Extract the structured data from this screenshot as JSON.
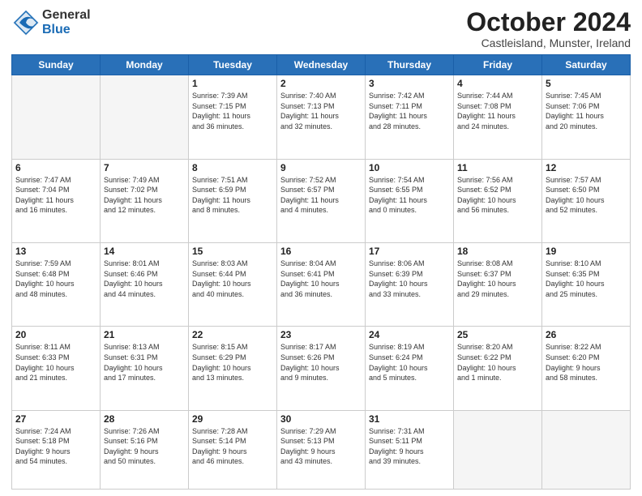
{
  "logo": {
    "general": "General",
    "blue": "Blue"
  },
  "title": "October 2024",
  "location": "Castleisland, Munster, Ireland",
  "days_of_week": [
    "Sunday",
    "Monday",
    "Tuesday",
    "Wednesday",
    "Thursday",
    "Friday",
    "Saturday"
  ],
  "weeks": [
    [
      {
        "day": "",
        "info": ""
      },
      {
        "day": "",
        "info": ""
      },
      {
        "day": "1",
        "info": "Sunrise: 7:39 AM\nSunset: 7:15 PM\nDaylight: 11 hours\nand 36 minutes."
      },
      {
        "day": "2",
        "info": "Sunrise: 7:40 AM\nSunset: 7:13 PM\nDaylight: 11 hours\nand 32 minutes."
      },
      {
        "day": "3",
        "info": "Sunrise: 7:42 AM\nSunset: 7:11 PM\nDaylight: 11 hours\nand 28 minutes."
      },
      {
        "day": "4",
        "info": "Sunrise: 7:44 AM\nSunset: 7:08 PM\nDaylight: 11 hours\nand 24 minutes."
      },
      {
        "day": "5",
        "info": "Sunrise: 7:45 AM\nSunset: 7:06 PM\nDaylight: 11 hours\nand 20 minutes."
      }
    ],
    [
      {
        "day": "6",
        "info": "Sunrise: 7:47 AM\nSunset: 7:04 PM\nDaylight: 11 hours\nand 16 minutes."
      },
      {
        "day": "7",
        "info": "Sunrise: 7:49 AM\nSunset: 7:02 PM\nDaylight: 11 hours\nand 12 minutes."
      },
      {
        "day": "8",
        "info": "Sunrise: 7:51 AM\nSunset: 6:59 PM\nDaylight: 11 hours\nand 8 minutes."
      },
      {
        "day": "9",
        "info": "Sunrise: 7:52 AM\nSunset: 6:57 PM\nDaylight: 11 hours\nand 4 minutes."
      },
      {
        "day": "10",
        "info": "Sunrise: 7:54 AM\nSunset: 6:55 PM\nDaylight: 11 hours\nand 0 minutes."
      },
      {
        "day": "11",
        "info": "Sunrise: 7:56 AM\nSunset: 6:52 PM\nDaylight: 10 hours\nand 56 minutes."
      },
      {
        "day": "12",
        "info": "Sunrise: 7:57 AM\nSunset: 6:50 PM\nDaylight: 10 hours\nand 52 minutes."
      }
    ],
    [
      {
        "day": "13",
        "info": "Sunrise: 7:59 AM\nSunset: 6:48 PM\nDaylight: 10 hours\nand 48 minutes."
      },
      {
        "day": "14",
        "info": "Sunrise: 8:01 AM\nSunset: 6:46 PM\nDaylight: 10 hours\nand 44 minutes."
      },
      {
        "day": "15",
        "info": "Sunrise: 8:03 AM\nSunset: 6:44 PM\nDaylight: 10 hours\nand 40 minutes."
      },
      {
        "day": "16",
        "info": "Sunrise: 8:04 AM\nSunset: 6:41 PM\nDaylight: 10 hours\nand 36 minutes."
      },
      {
        "day": "17",
        "info": "Sunrise: 8:06 AM\nSunset: 6:39 PM\nDaylight: 10 hours\nand 33 minutes."
      },
      {
        "day": "18",
        "info": "Sunrise: 8:08 AM\nSunset: 6:37 PM\nDaylight: 10 hours\nand 29 minutes."
      },
      {
        "day": "19",
        "info": "Sunrise: 8:10 AM\nSunset: 6:35 PM\nDaylight: 10 hours\nand 25 minutes."
      }
    ],
    [
      {
        "day": "20",
        "info": "Sunrise: 8:11 AM\nSunset: 6:33 PM\nDaylight: 10 hours\nand 21 minutes."
      },
      {
        "day": "21",
        "info": "Sunrise: 8:13 AM\nSunset: 6:31 PM\nDaylight: 10 hours\nand 17 minutes."
      },
      {
        "day": "22",
        "info": "Sunrise: 8:15 AM\nSunset: 6:29 PM\nDaylight: 10 hours\nand 13 minutes."
      },
      {
        "day": "23",
        "info": "Sunrise: 8:17 AM\nSunset: 6:26 PM\nDaylight: 10 hours\nand 9 minutes."
      },
      {
        "day": "24",
        "info": "Sunrise: 8:19 AM\nSunset: 6:24 PM\nDaylight: 10 hours\nand 5 minutes."
      },
      {
        "day": "25",
        "info": "Sunrise: 8:20 AM\nSunset: 6:22 PM\nDaylight: 10 hours\nand 1 minute."
      },
      {
        "day": "26",
        "info": "Sunrise: 8:22 AM\nSunset: 6:20 PM\nDaylight: 9 hours\nand 58 minutes."
      }
    ],
    [
      {
        "day": "27",
        "info": "Sunrise: 7:24 AM\nSunset: 5:18 PM\nDaylight: 9 hours\nand 54 minutes."
      },
      {
        "day": "28",
        "info": "Sunrise: 7:26 AM\nSunset: 5:16 PM\nDaylight: 9 hours\nand 50 minutes."
      },
      {
        "day": "29",
        "info": "Sunrise: 7:28 AM\nSunset: 5:14 PM\nDaylight: 9 hours\nand 46 minutes."
      },
      {
        "day": "30",
        "info": "Sunrise: 7:29 AM\nSunset: 5:13 PM\nDaylight: 9 hours\nand 43 minutes."
      },
      {
        "day": "31",
        "info": "Sunrise: 7:31 AM\nSunset: 5:11 PM\nDaylight: 9 hours\nand 39 minutes."
      },
      {
        "day": "",
        "info": ""
      },
      {
        "day": "",
        "info": ""
      }
    ]
  ]
}
